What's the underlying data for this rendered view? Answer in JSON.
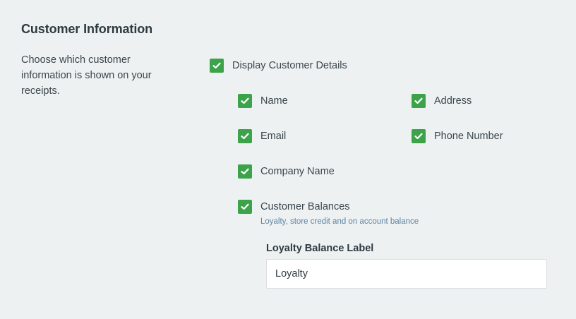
{
  "section": {
    "title": "Customer Information",
    "description": "Choose which customer information is shown on your receipts."
  },
  "options": {
    "display_customer_details": {
      "label": "Display Customer Details",
      "checked": true
    },
    "name": {
      "label": "Name",
      "checked": true
    },
    "address": {
      "label": "Address",
      "checked": true
    },
    "email": {
      "label": "Email",
      "checked": true
    },
    "phone_number": {
      "label": "Phone Number",
      "checked": true
    },
    "company_name": {
      "label": "Company Name",
      "checked": true
    },
    "customer_balances": {
      "label": "Customer Balances",
      "checked": true,
      "hint": "Loyalty, store credit and on account balance"
    }
  },
  "loyalty_balance": {
    "label": "Loyalty Balance Label",
    "value": "Loyalty"
  },
  "colors": {
    "background": "#eef1f1",
    "checkbox_checked": "#3ca34a",
    "hint_text": "#5b84a6"
  },
  "icons": {
    "checkbox": "check-icon"
  }
}
